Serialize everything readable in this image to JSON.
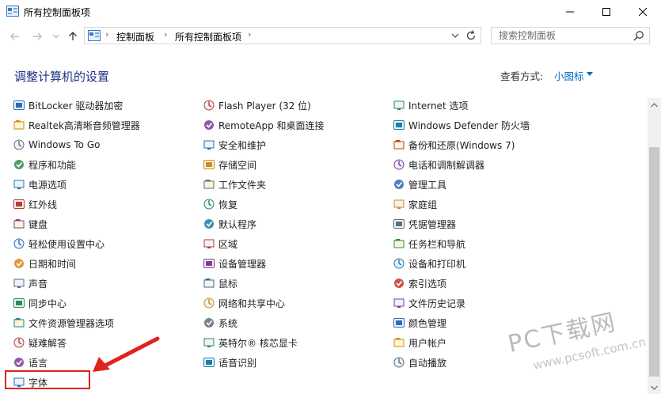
{
  "window": {
    "title": "所有控制面板项"
  },
  "address": {
    "crumbs": [
      "控制面板",
      "所有控制面板项"
    ]
  },
  "search": {
    "placeholder": "搜索控制面板"
  },
  "header": {
    "title": "调整计算机的设置",
    "view_by_label": "查看方式:",
    "view_by_value": "小图标"
  },
  "items": [
    [
      "BitLocker 驱动器加密",
      "Flash Player (32 位)",
      "Internet 选项"
    ],
    [
      "Realtek高清晰音频管理器",
      "RemoteApp 和桌面连接",
      "Windows Defender 防火墙"
    ],
    [
      "Windows To Go",
      "安全和维护",
      "备份和还原(Windows 7)"
    ],
    [
      "程序和功能",
      "存储空间",
      "电话和调制解调器"
    ],
    [
      "电源选项",
      "工作文件夹",
      "管理工具"
    ],
    [
      "红外线",
      "恢复",
      "家庭组"
    ],
    [
      "键盘",
      "默认程序",
      "凭据管理器"
    ],
    [
      "轻松使用设置中心",
      "区域",
      "任务栏和导航"
    ],
    [
      "日期和时间",
      "设备管理器",
      "设备和打印机"
    ],
    [
      "声音",
      "鼠标",
      "索引选项"
    ],
    [
      "同步中心",
      "网络和共享中心",
      "文件历史记录"
    ],
    [
      "文件资源管理器选项",
      "系统",
      "颜色管理"
    ],
    [
      "疑难解答",
      "英特尔® 核芯显卡",
      "用户帐户"
    ],
    [
      "语言",
      "语音识别",
      "自动播放"
    ],
    [
      "字体"
    ]
  ],
  "icons": [
    [
      "bitlocker-icon",
      "flash-player-icon",
      "internet-options-icon"
    ],
    [
      "audio-manager-icon",
      "remoteapp-icon",
      "firewall-icon"
    ],
    [
      "windows-to-go-icon",
      "security-flag-icon",
      "backup-restore-icon"
    ],
    [
      "programs-icon",
      "storage-spaces-icon",
      "phone-modem-icon"
    ],
    [
      "power-options-icon",
      "work-folders-icon",
      "admin-tools-icon"
    ],
    [
      "infrared-icon",
      "recovery-icon",
      "homegroup-icon"
    ],
    [
      "keyboard-icon",
      "default-programs-icon",
      "credential-manager-icon"
    ],
    [
      "ease-of-access-icon",
      "region-icon",
      "taskbar-icon"
    ],
    [
      "date-time-icon",
      "device-manager-icon",
      "devices-printers-icon"
    ],
    [
      "sound-icon",
      "mouse-icon",
      "indexing-options-icon"
    ],
    [
      "sync-center-icon",
      "network-sharing-icon",
      "file-history-icon"
    ],
    [
      "explorer-options-icon",
      "system-icon",
      "color-management-icon"
    ],
    [
      "troubleshooting-icon",
      "intel-graphics-icon",
      "user-accounts-icon"
    ],
    [
      "language-icon",
      "speech-recognition-icon",
      "autoplay-icon"
    ],
    [
      "fonts-icon"
    ]
  ],
  "watermark": {
    "big": "PC下载网",
    "small": "www.pcsoft.com.cn"
  },
  "colors": {
    "title_blue": "#1e3287",
    "link_blue": "#0066cc",
    "highlight_red": "#e0231e"
  }
}
